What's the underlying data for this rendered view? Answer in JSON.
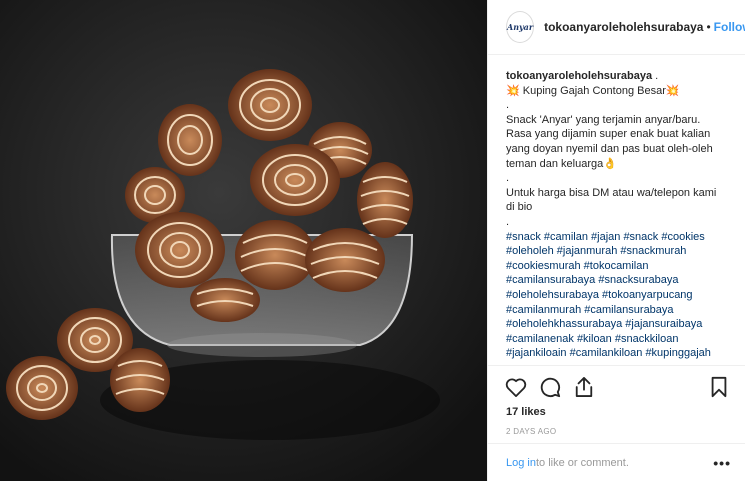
{
  "header": {
    "avatar_text": "Anyar",
    "username": "tokoanyaroleholehsurabaya",
    "separator": "•",
    "follow_label": "Follow"
  },
  "caption": {
    "username": "tokoanyaroleholehsurabaya",
    "username_suffix": " .",
    "title_emoji_left": "💥",
    "title": " Kuping Gajah Contong Besar",
    "title_emoji_right": "💥",
    "dot1": ".",
    "body_lines": [
      "Snack 'Anyar' yang terjamin anyar/baru.",
      "Rasa yang dijamin super enak buat kalian",
      "yang doyan nyemil dan pas buat oleh-oleh"
    ],
    "body_last": "teman dan keluarga",
    "body_emoji": "👌",
    "dot2": ".",
    "price_lines": [
      "Untuk harga bisa DM atau wa/telepon kami",
      "di bio"
    ],
    "dot3": ".",
    "hashtag_lines": [
      [
        "#snack",
        "#camilan",
        "#jajan",
        "#snack",
        "#cookies"
      ],
      [
        "#oleholeh",
        "#jajanmurah",
        "#snackmurah"
      ],
      [
        "#cookiesmurah",
        "#tokocamilan"
      ],
      [
        "#camilansurabaya",
        "#snacksurabaya"
      ],
      [
        "#oleholehsurabaya",
        "#tokoanyarpucang"
      ],
      [
        "#camilanmurah",
        "#camilansurabaya"
      ],
      [
        "#oleholehkhassurabaya",
        "#jajansuraibaya"
      ],
      [
        "#camilanenak",
        "#kiloan",
        "#snackkiloan"
      ],
      [
        "#jajankiloain",
        "#camilankiloan",
        "#kupinggajah"
      ]
    ]
  },
  "actions": {
    "like_icon": "heart-icon",
    "comment_icon": "comment-bubble-icon",
    "share_icon": "share-icon",
    "save_icon": "bookmark-icon"
  },
  "likes_text": "17 likes",
  "date_text": "2 DAYS AGO",
  "comment_bar": {
    "login_label": "Log in",
    "rest_text": " to like or comment.",
    "more_label": "•••"
  },
  "colors": {
    "link_blue": "#3897f0",
    "hashtag": "#003569",
    "photo_bg": "#1e1e1e",
    "cookie": "#7a3e22"
  }
}
